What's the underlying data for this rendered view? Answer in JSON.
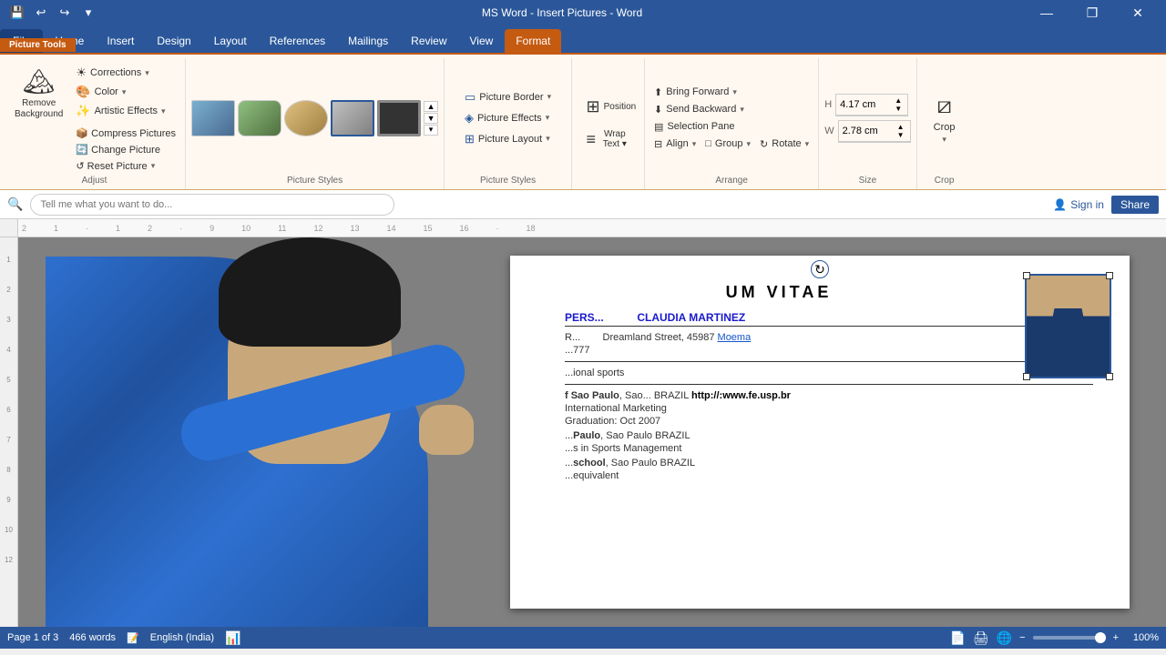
{
  "titlebar": {
    "title": "MS Word - Insert Pictures - Word",
    "quick_access": [
      "💾",
      "↩",
      "↪",
      "🖊"
    ],
    "win_controls": [
      "—",
      "❐",
      "✕"
    ]
  },
  "ribbon_tabs": [
    {
      "id": "file",
      "label": "File",
      "active": false
    },
    {
      "id": "home",
      "label": "Home",
      "active": false
    },
    {
      "id": "insert",
      "label": "Insert",
      "active": false
    },
    {
      "id": "design",
      "label": "Design",
      "active": false
    },
    {
      "id": "layout",
      "label": "Layout",
      "active": false
    },
    {
      "id": "references",
      "label": "References",
      "active": false
    },
    {
      "id": "mailings",
      "label": "Mailings",
      "active": false
    },
    {
      "id": "review",
      "label": "Review",
      "active": false
    },
    {
      "id": "view",
      "label": "View",
      "active": false
    },
    {
      "id": "format",
      "label": "Format",
      "active": true
    }
  ],
  "ribbon": {
    "groups": [
      {
        "id": "adjust",
        "label": "Adjust",
        "items": [
          {
            "id": "remove-background",
            "label": "Remove\nBackground",
            "icon": "🖼"
          },
          {
            "id": "corrections",
            "label": "Corrections ▾",
            "icon": "☀"
          },
          {
            "id": "color",
            "label": "Color ▾",
            "icon": "🎨"
          },
          {
            "id": "artistic-effects",
            "label": "Artistic Effects ▾",
            "icon": "✨"
          },
          {
            "id": "compress-pictures",
            "label": "Compress Pictures",
            "icon": "📦"
          },
          {
            "id": "change-picture",
            "label": "Change Picture",
            "icon": "🔄"
          },
          {
            "id": "reset-picture",
            "label": "Reset Picture ▾",
            "icon": "↺"
          }
        ]
      }
    ]
  },
  "format_ribbon": {
    "tab_label": "Picture Tools",
    "tab_sublabel": "Format",
    "groups": [
      {
        "id": "adjust",
        "label": "Adjust",
        "items": [
          {
            "id": "remove-bg",
            "label": "Remove\nBackground",
            "icon": "🏔"
          },
          {
            "id": "corrections-btn",
            "label": "Corrections ▾",
            "small": true
          },
          {
            "id": "color-btn",
            "label": "Color ▾",
            "small": true
          },
          {
            "id": "artistic-btn",
            "label": "Artistic Effects ▾",
            "small": true
          },
          {
            "id": "compress-btn",
            "label": "Compress Pictures",
            "small": true
          },
          {
            "id": "change-btn",
            "label": "Change Picture",
            "small": true
          },
          {
            "id": "reset-btn",
            "label": "Reset Picture ▾",
            "small": true
          }
        ]
      },
      {
        "id": "picture-styles",
        "label": "Picture Styles",
        "gallery_count": 4
      },
      {
        "id": "picture-border",
        "label": "Arrange",
        "items": [
          {
            "id": "picture-border-btn",
            "label": "Picture Border ▾"
          },
          {
            "id": "picture-effects-btn",
            "label": "Picture Effects ▾"
          },
          {
            "id": "picture-layout-btn",
            "label": "Picture Layout ▾"
          }
        ]
      },
      {
        "id": "arrange",
        "label": "Arrange",
        "items": [
          {
            "id": "bring-forward-btn",
            "label": "Bring Forward ▾"
          },
          {
            "id": "send-backward-btn",
            "label": "Send Backward ▾"
          },
          {
            "id": "selection-pane-btn",
            "label": "Selection Pane"
          },
          {
            "id": "align-btn",
            "label": "Align ▾"
          },
          {
            "id": "group-btn",
            "label": "Group ▾"
          },
          {
            "id": "rotate-btn",
            "label": "Rotate ▾"
          }
        ]
      },
      {
        "id": "position-wrap",
        "label": "",
        "items": [
          {
            "id": "position-btn",
            "label": "Position"
          },
          {
            "id": "wrap-text-btn",
            "label": "Wrap\nText ▾"
          }
        ]
      },
      {
        "id": "size",
        "label": "Size",
        "height": "4.17 cm",
        "width": "2.78 cm"
      },
      {
        "id": "crop",
        "label": "Crop",
        "icon": "✂"
      }
    ]
  },
  "searchbar": {
    "placeholder": "Tell me what you want to do...",
    "signin_label": "Sign in",
    "share_label": "Share"
  },
  "document": {
    "title": "UM VITAE",
    "section_personal": "PERS... CLAUDIA MARTINEZ",
    "address": "Dreamland Street, 45987 Moema",
    "phone": "...777",
    "divider1": true,
    "interests": "...ional sports",
    "divider2": true,
    "edu1_name": "f Sao Paulo",
    "edu1_loc": "Sao... BRAZIL",
    "edu1_url": "http://:www.fe.usp.br",
    "edu1_course": "International Marketing",
    "edu1_grad": "Graduation: Oct 2007",
    "edu2_name": "Paulo",
    "edu2_loc": "Sao Paulo BRAZIL",
    "edu2_course": "s in Sports Management",
    "edu3_name": "...school",
    "edu3_loc": "Sao Paulo BRAZIL",
    "edu3_detail": "...equivalent"
  },
  "statusbar": {
    "page_info": "Page 1 of 3",
    "words": "466 words",
    "language": "English (India)",
    "zoom": "100%"
  }
}
